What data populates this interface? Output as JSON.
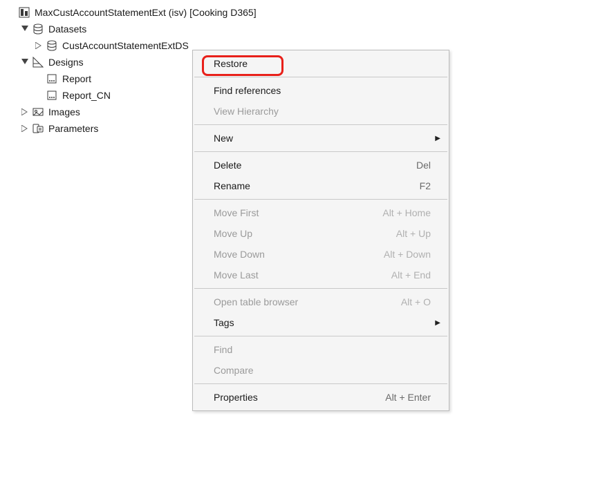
{
  "tree": {
    "root": {
      "label": "MaxCustAccountStatementExt (isv) [Cooking D365]",
      "iconName": "report-root-icon"
    },
    "datasets": {
      "label": "Datasets",
      "iconName": "database-icon"
    },
    "ds_child": {
      "label": "CustAccountStatementExtDS",
      "iconName": "database-icon"
    },
    "designs": {
      "label": "Designs",
      "iconName": "designs-icon"
    },
    "design1": {
      "label": "Report",
      "iconName": "report-icon"
    },
    "design2": {
      "label": "Report_CN",
      "iconName": "report-icon"
    },
    "images": {
      "label": "Images",
      "iconName": "images-icon"
    },
    "parameters": {
      "label": "Parameters",
      "iconName": "parameters-icon"
    }
  },
  "menu": {
    "restore": {
      "label": "Restore"
    },
    "findrefs": {
      "label": "Find references"
    },
    "viewhier": {
      "label": "View Hierarchy"
    },
    "new": {
      "label": "New"
    },
    "delete": {
      "label": "Delete",
      "shortcut": "Del"
    },
    "rename": {
      "label": "Rename",
      "shortcut": "F2"
    },
    "movefirst": {
      "label": "Move First",
      "shortcut": "Alt + Home"
    },
    "moveup": {
      "label": "Move Up",
      "shortcut": "Alt + Up"
    },
    "movedown": {
      "label": "Move Down",
      "shortcut": "Alt + Down"
    },
    "movelast": {
      "label": "Move Last",
      "shortcut": "Alt + End"
    },
    "opentable": {
      "label": "Open table browser",
      "shortcut": "Alt + O"
    },
    "tags": {
      "label": "Tags"
    },
    "find": {
      "label": "Find"
    },
    "compare": {
      "label": "Compare"
    },
    "properties": {
      "label": "Properties",
      "shortcut": "Alt + Enter"
    }
  }
}
